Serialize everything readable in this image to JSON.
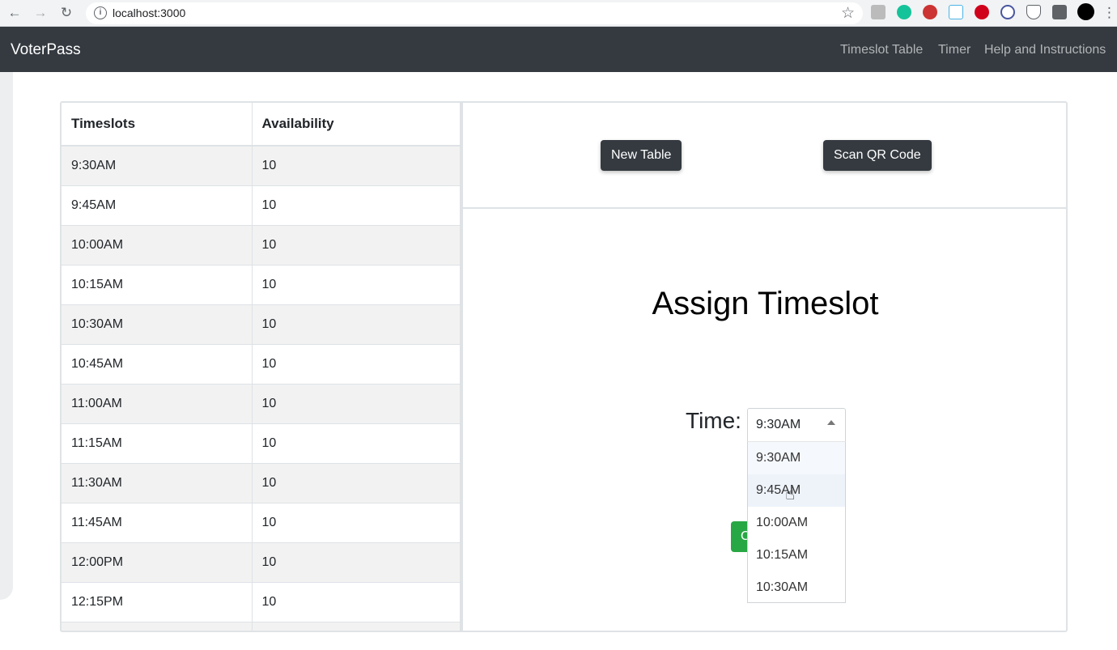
{
  "browser": {
    "url": "localhost:3000"
  },
  "navbar": {
    "brand": "VoterPass",
    "links": [
      "Timeslot Table",
      "Timer",
      "Help and Instructions"
    ]
  },
  "table": {
    "headers": [
      "Timeslots",
      "Availability"
    ],
    "rows": [
      [
        "9:30AM",
        "10"
      ],
      [
        "9:45AM",
        "10"
      ],
      [
        "10:00AM",
        "10"
      ],
      [
        "10:15AM",
        "10"
      ],
      [
        "10:30AM",
        "10"
      ],
      [
        "10:45AM",
        "10"
      ],
      [
        "11:00AM",
        "10"
      ],
      [
        "11:15AM",
        "10"
      ],
      [
        "11:30AM",
        "10"
      ],
      [
        "11:45AM",
        "10"
      ],
      [
        "12:00PM",
        "10"
      ],
      [
        "12:15PM",
        "10"
      ],
      [
        "",
        ""
      ]
    ]
  },
  "actions": {
    "new_table": "New Table",
    "scan_qr": "Scan QR Code"
  },
  "assign": {
    "title": "Assign Timeslot",
    "time_label": "Time:",
    "selected": "9:30AM",
    "options": [
      "9:30AM",
      "9:45AM",
      "10:00AM",
      "10:15AM",
      "10:30AM"
    ],
    "hidden_button_label": "C"
  },
  "colors": {
    "navbar": "#343a40",
    "confirm_button": "#28a745"
  }
}
